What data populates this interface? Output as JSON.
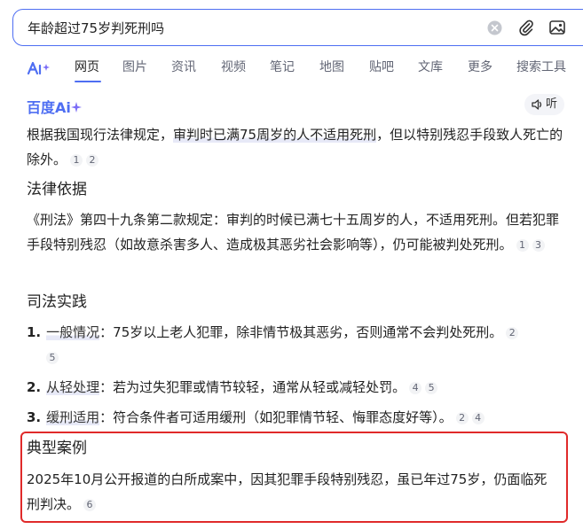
{
  "search": {
    "query": "年龄超过75岁判死刑吗"
  },
  "tabs": [
    {
      "label": "网页",
      "active": true
    },
    {
      "label": "图片"
    },
    {
      "label": "资讯"
    },
    {
      "label": "视频"
    },
    {
      "label": "笔记"
    },
    {
      "label": "地图"
    },
    {
      "label": "贴吧"
    },
    {
      "label": "文库"
    },
    {
      "label": "更多"
    },
    {
      "label": "搜索工具"
    }
  ],
  "brand": {
    "name": "百度",
    "ai_suffix": "Ai"
  },
  "listen_label": "听",
  "answer": {
    "intro_pre": "根据我国现行法律规定，",
    "intro_hl": "审判时已满75周岁的人不适用死刑",
    "intro_post": "，但以特别残忍手段致人死亡的除外。",
    "intro_refs": [
      "1",
      "2"
    ],
    "legal_basis_title": "法律依据",
    "legal_basis_text": "《刑法》第四十九条第二款规定：审判的时候已满七十五周岁的人，不适用死刑。但若犯罪手段特别残忍（如故意杀害多人、造成极其恶劣社会影响等），仍可能被判处死刑。",
    "legal_basis_refs": [
      "1",
      "3"
    ],
    "practice_title": "司法实践",
    "practice_items": [
      {
        "num": "1.",
        "term": "一般情况",
        "text": "：75岁以上老人犯罪，除非情节极其恶劣，否则通常不会判处死刑。",
        "refs": [
          "2",
          "5"
        ]
      },
      {
        "num": "2.",
        "term": "从轻处理",
        "text": "：若为过失犯罪或情节较轻，通常从轻或减轻处罚。",
        "refs": [
          "4",
          "5"
        ]
      },
      {
        "num": "3.",
        "term": "缓刑适用",
        "text": "：符合条件者可适用缓刑（如犯罪情节轻、悔罪态度好等）。",
        "refs": [
          "2",
          "4"
        ]
      }
    ],
    "case_title": "典型案例",
    "case_text": "2025年10月公开报道的白所成案中，因其犯罪手段特别残忍，虽已年过75岁，仍面临死刑判决。",
    "case_refs": [
      "6"
    ]
  },
  "colors": {
    "accent": "#4e6ef2",
    "highlight_box": "#e02a2a"
  }
}
